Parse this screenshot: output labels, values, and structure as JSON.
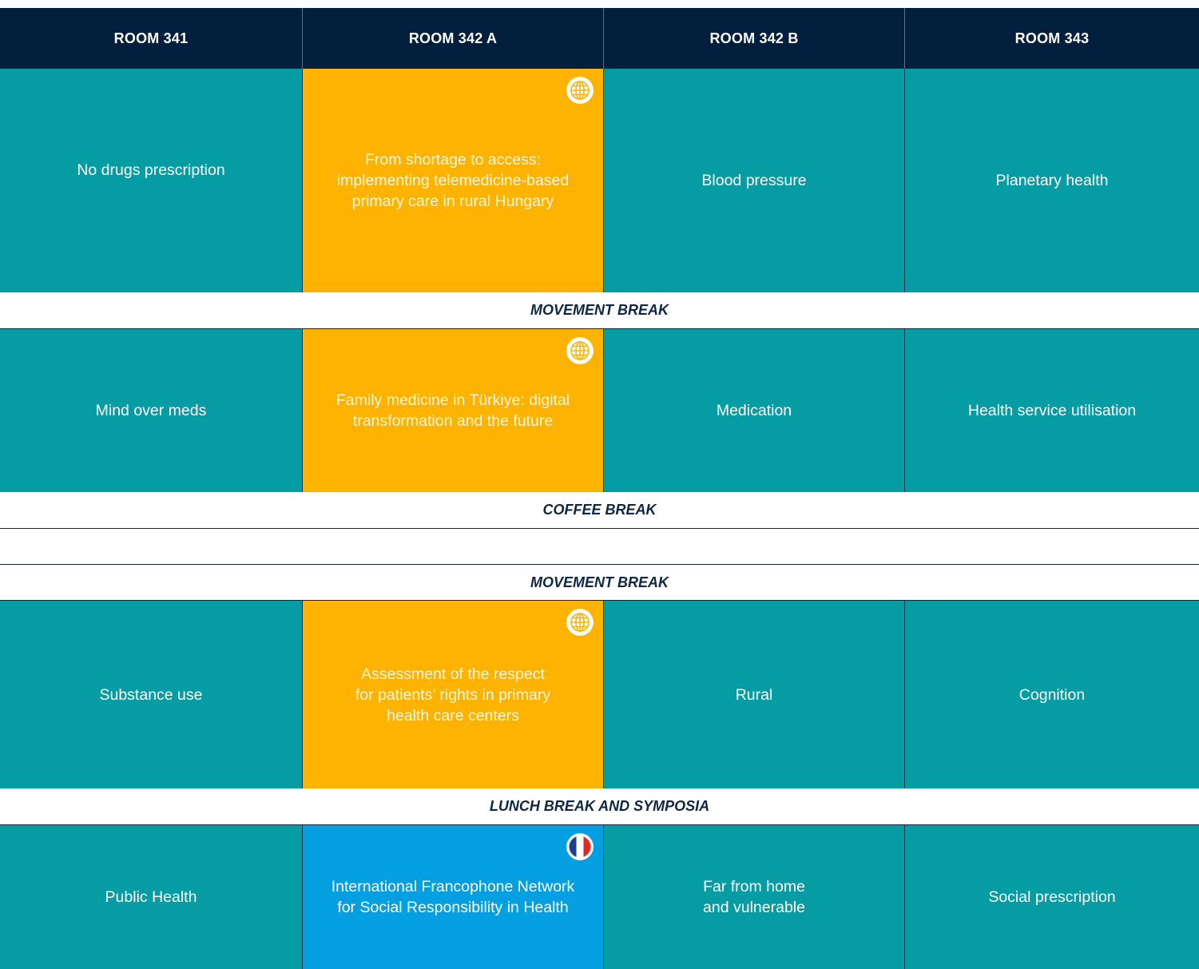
{
  "header": {
    "rooms": [
      "ROOM 341",
      "ROOM 342 A",
      "ROOM 342 B",
      "ROOM 343"
    ]
  },
  "sessions": [
    {
      "cells": [
        {
          "text": "No drugs prescription",
          "color": "#059ca3"
        },
        {
          "text": "From shortage to access:\nimplementing telemedicine-based\nprimary care in rural Hungary",
          "color": "#fdb300",
          "icon": "globe-icon"
        },
        {
          "text": "Blood pressure",
          "color": "#059ca3"
        },
        {
          "text": "Planetary health",
          "color": "#059ca3"
        }
      ]
    },
    {
      "cells": [
        {
          "text": "Mind over meds",
          "color": "#059ca3"
        },
        {
          "text": "Family medicine in Türkiye: digital\ntransformation and the future",
          "color": "#fdb300",
          "icon": "globe-icon"
        },
        {
          "text": "Medication",
          "color": "#059ca3"
        },
        {
          "text": "Health service utilisation",
          "color": "#059ca3"
        }
      ]
    },
    {
      "cells": [
        {
          "text": "Substance use",
          "color": "#059ca3"
        },
        {
          "text": "Assessment of the respect\nfor patients’ rights in primary\nhealth care centers",
          "color": "#fdb300",
          "icon": "globe-icon"
        },
        {
          "text": "Rural",
          "color": "#059ca3"
        },
        {
          "text": "Cognition",
          "color": "#059ca3"
        }
      ]
    },
    {
      "cells": [
        {
          "text": "Public Health",
          "color": "#059ca3"
        },
        {
          "text": "International Francophone Network\nfor Social Responsibility in Health",
          "color": "#049fe0",
          "icon": "french-flag-icon"
        },
        {
          "text": "Far from home\nand vulnerable",
          "color": "#059ca3"
        },
        {
          "text": "Social prescription",
          "color": "#059ca3"
        }
      ]
    }
  ],
  "breaks": {
    "movement_1": "MOVEMENT BREAK",
    "coffee": "COFFEE BREAK",
    "movement_2": "MOVEMENT BREAK",
    "lunch": "LUNCH BREAK AND SYMPOSIA"
  },
  "colors": {
    "header_bg": "#02203e",
    "teal": "#059ca3",
    "orange": "#fdb300",
    "blue": "#049fe0",
    "break_text": "#0d2744"
  }
}
